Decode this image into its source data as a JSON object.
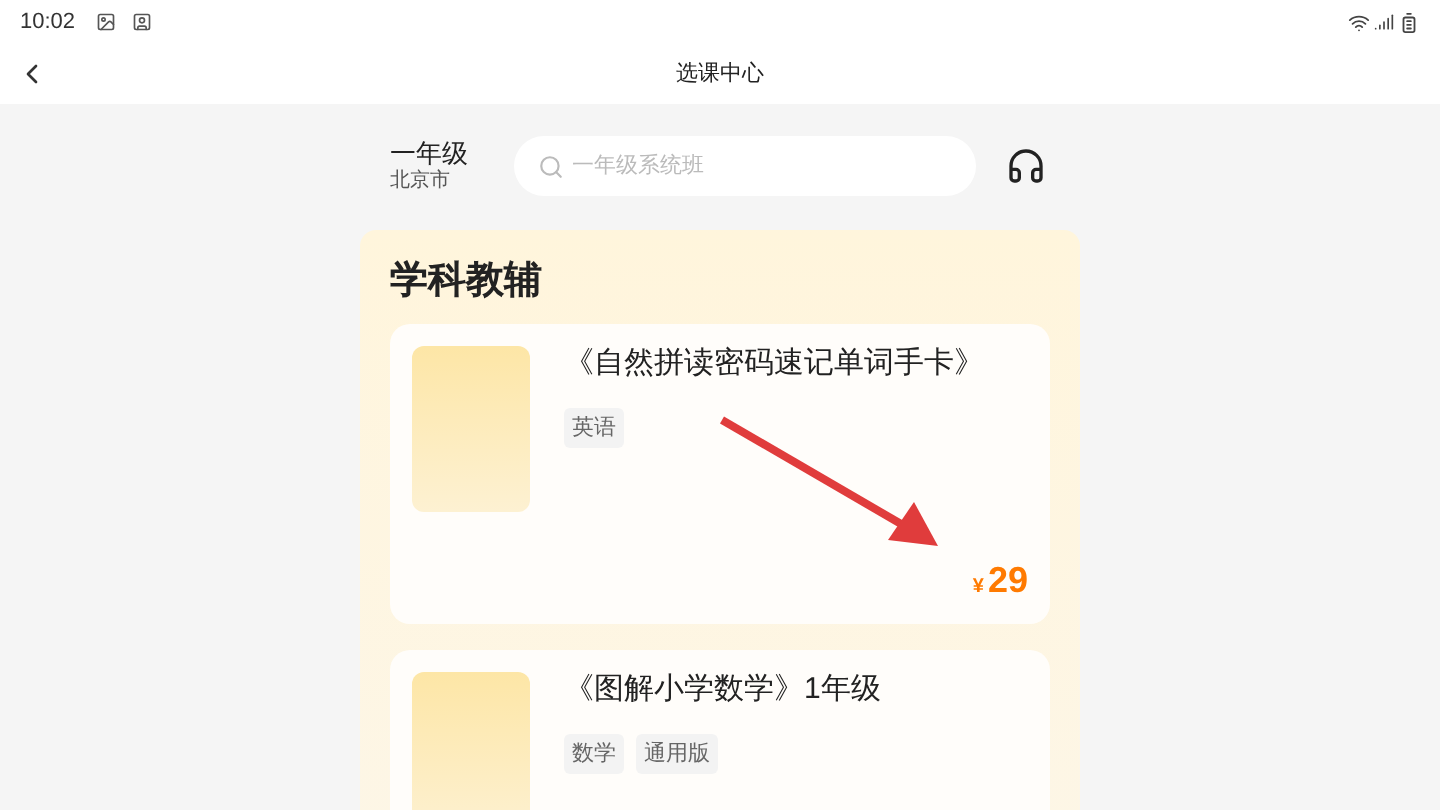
{
  "status_bar": {
    "time": "10:02"
  },
  "header": {
    "title": "选课中心"
  },
  "location": {
    "grade": "一年级",
    "city": "北京市"
  },
  "search": {
    "placeholder": "一年级系统班"
  },
  "section": {
    "title": "学科教辅",
    "products": [
      {
        "title": "《自然拼读密码速记单词手卡》",
        "tags": [
          "英语"
        ],
        "price_symbol": "¥",
        "price": "29"
      },
      {
        "title": "《图解小学数学》1年级",
        "tags": [
          "数学",
          "通用版"
        ]
      }
    ]
  }
}
